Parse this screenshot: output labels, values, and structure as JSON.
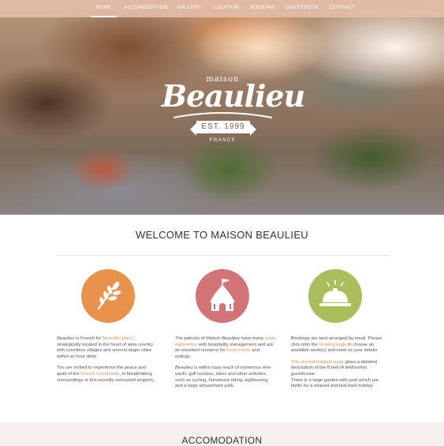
{
  "nav": {
    "items": [
      {
        "label": "HOME",
        "active": true
      },
      {
        "label": "ACCOMODATION",
        "active": false
      },
      {
        "label": "GALLERY",
        "active": false
      },
      {
        "label": "LOCATION",
        "active": false
      },
      {
        "label": "BOOKING",
        "active": false
      },
      {
        "label": "GUESTBOOK",
        "active": false
      },
      {
        "label": "CONTACT",
        "active": false
      }
    ]
  },
  "logo": {
    "maison": "maison",
    "name": "Beaulieu",
    "established": "EST. 1999",
    "country": "FRANCE"
  },
  "welcome": {
    "title": "WELCOME TO MAISON BEAULIEU"
  },
  "features": [
    {
      "icon": "wheat-icon",
      "color": "#e9924b"
    },
    {
      "icon": "tent-icon",
      "color": "#d27476"
    },
    {
      "icon": "service-bell-icon",
      "color": "#a9bf5c"
    }
  ],
  "columns": {
    "col1": {
      "p1_a": "Beaulieu",
      "p1_b": " is French for '",
      "p1_link": "beautiful place",
      "p1_c": "', strategically located in the heart of wine country with countless villages and several larger cities within an hour drive.",
      "p2_a": "You are invited to experience the peace and quiet of the ",
      "p2_link": "French countryside",
      "p2_b": ", in breathtaking surroundings at this recently renovated property."
    },
    "col2": {
      "p1_a": "The patrons of ",
      "p1_em": "Maison Beaulieu",
      "p1_b": " have many ",
      "p1_link": "years experience",
      "p1_c": " with hospitality management and are an excellent resource for ",
      "p1_link2": "local events",
      "p1_d": " and outings.",
      "p2_em": "Beaulieu",
      "p2_b": " is within easy reach of numerous vine-yards, golf courses, lakes and other activities such as cycling, horseback riding, sightseeing and a large amusement park."
    },
    "col3": {
      "p1_a": "Bookings are best arranged by email. Please click onto the ",
      "p1_link": "booking page",
      "p1_b": " to choose an available week(s) and send us your details.",
      "p2_link": "The accommodation page",
      "p2_b": " gives a detailed description of the 8 bed (4 bedrooms) guesthouse",
      "p3": "There is a large garden with pool which are idyllic for a relaxed and laid back holiday."
    }
  },
  "accomodation": {
    "title": "ACCOMODATION"
  }
}
